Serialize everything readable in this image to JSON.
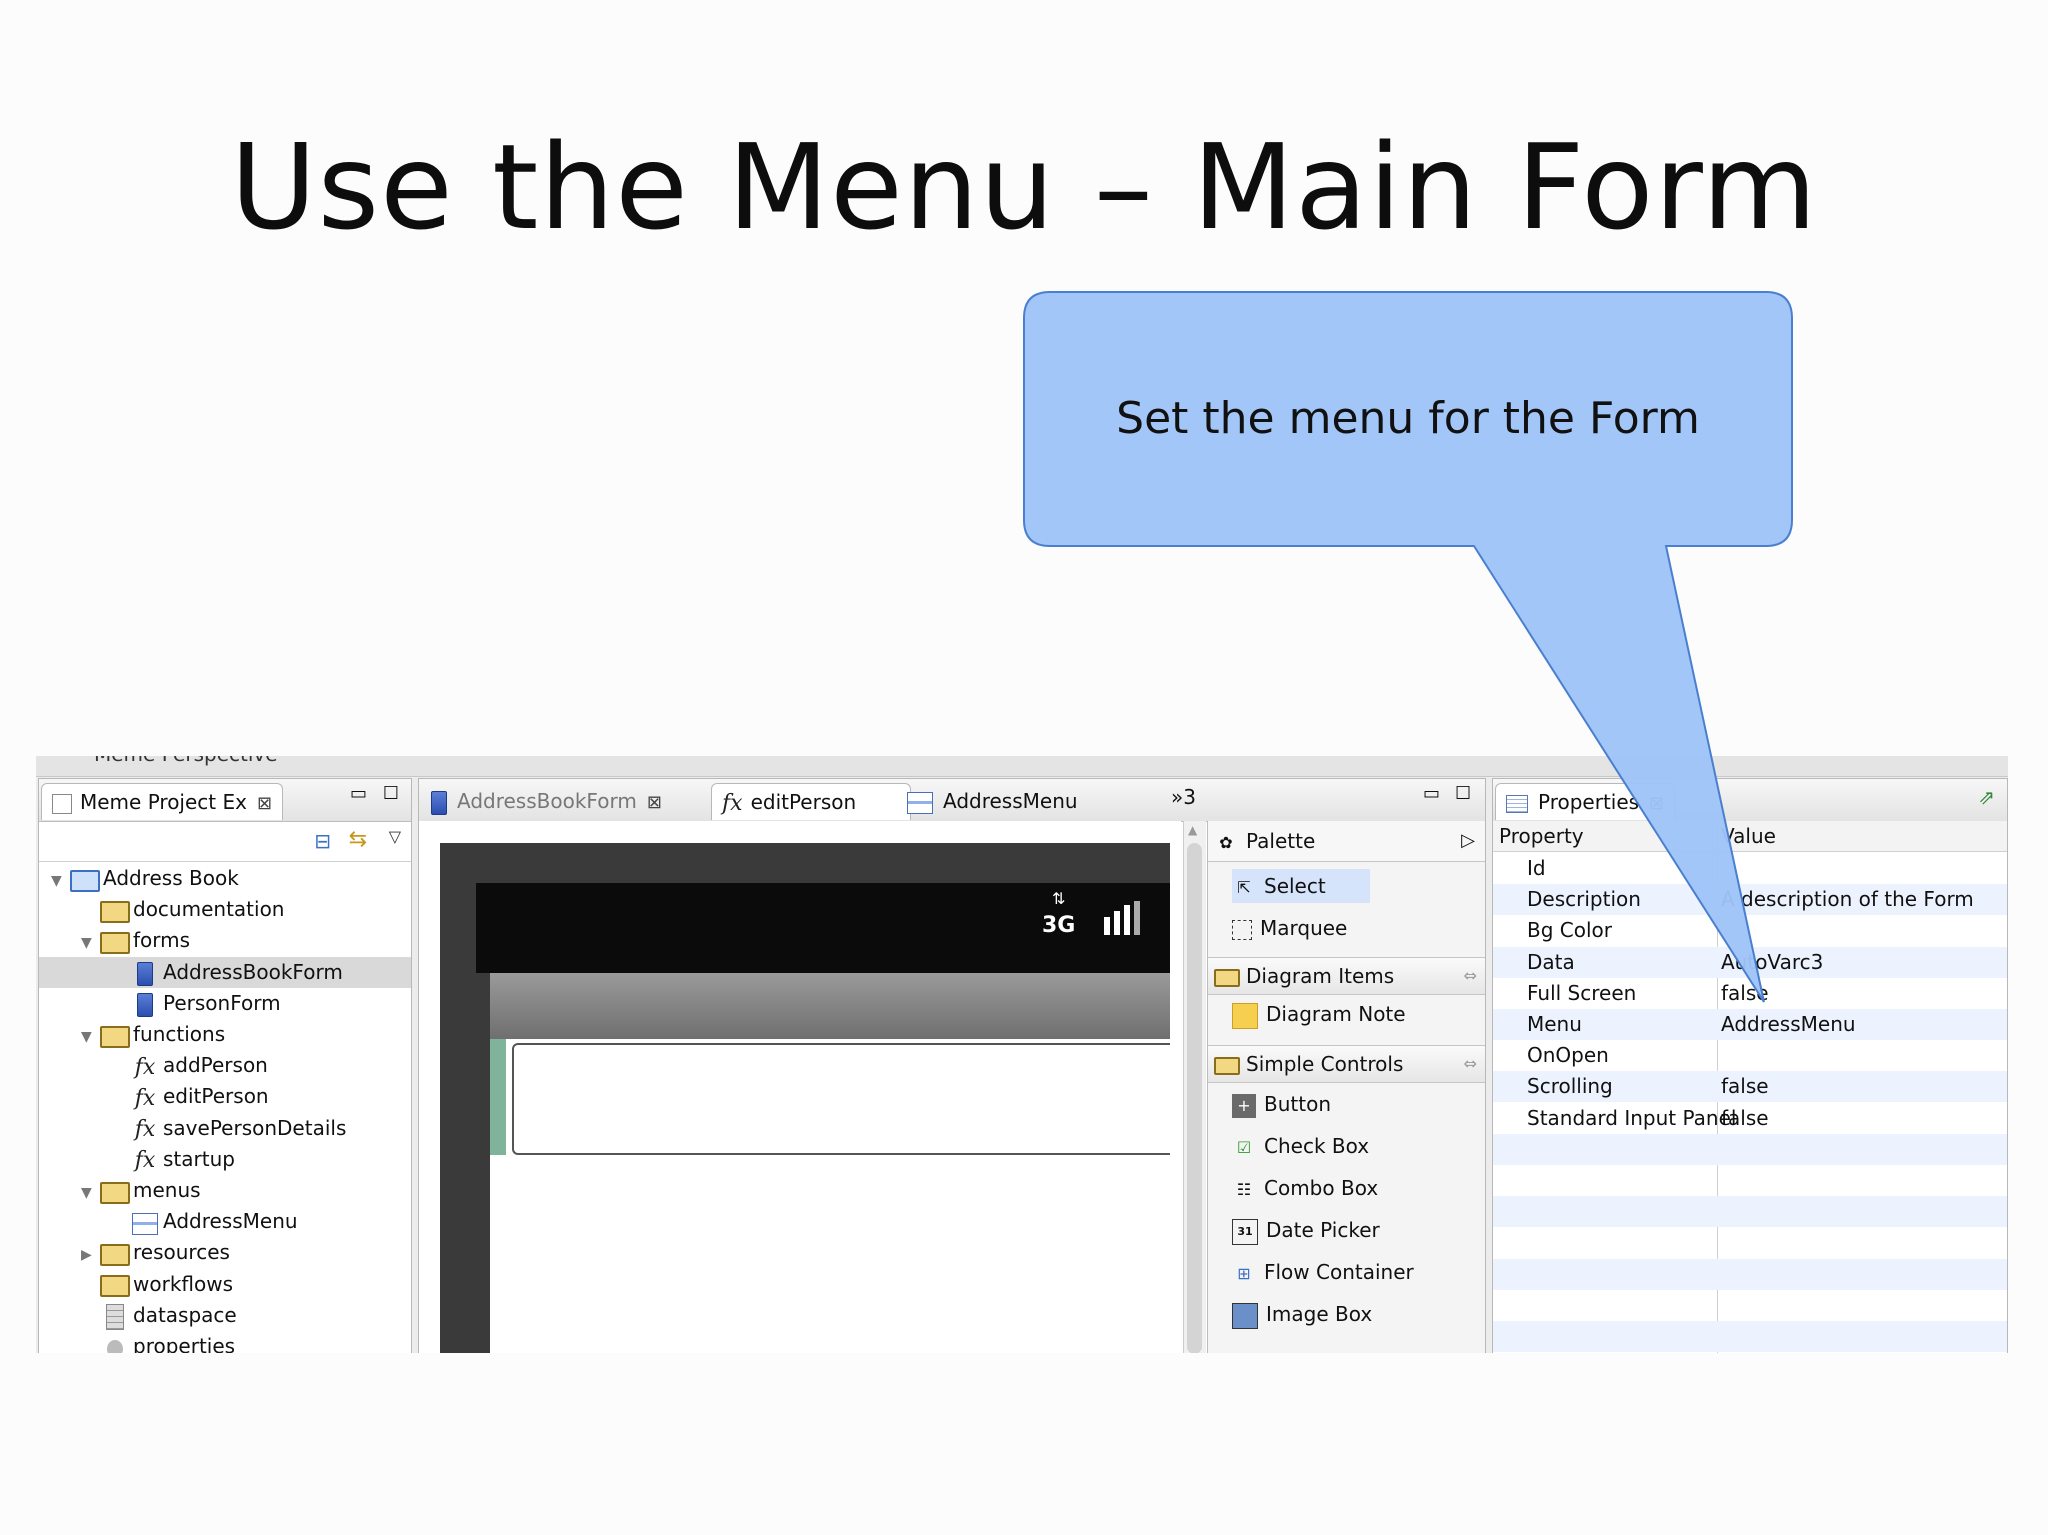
{
  "slide": {
    "title": "Use the Menu – Main Form"
  },
  "callout": {
    "text": "Set the menu for the Form"
  },
  "perspective_label": "Meme Perspective",
  "explorer": {
    "tab_label": "Meme Project Ex",
    "tree": [
      {
        "label": "Address Book",
        "icon": "project-folder-icon",
        "level": 0,
        "expanded": true
      },
      {
        "label": "documentation",
        "icon": "folder-icon",
        "level": 1
      },
      {
        "label": "forms",
        "icon": "folder-icon",
        "level": 1,
        "expanded": true
      },
      {
        "label": "AddressBookForm",
        "icon": "form-icon",
        "level": 2,
        "selected": true
      },
      {
        "label": "PersonForm",
        "icon": "form-icon",
        "level": 2
      },
      {
        "label": "functions",
        "icon": "folder-icon",
        "level": 1,
        "expanded": true
      },
      {
        "label": "addPerson",
        "icon": "function-icon",
        "level": 2
      },
      {
        "label": "editPerson",
        "icon": "function-icon",
        "level": 2
      },
      {
        "label": "savePersonDetails",
        "icon": "function-icon",
        "level": 2
      },
      {
        "label": "startup",
        "icon": "function-icon",
        "level": 2
      },
      {
        "label": "menus",
        "icon": "folder-icon",
        "level": 1,
        "expanded": true
      },
      {
        "label": "AddressMenu",
        "icon": "menu-icon",
        "level": 2
      },
      {
        "label": "resources",
        "icon": "folder-icon",
        "level": 1,
        "collapsed": true
      },
      {
        "label": "workflows",
        "icon": "folder-icon",
        "level": 1
      },
      {
        "label": "dataspace",
        "icon": "database-icon",
        "level": 1
      },
      {
        "label": "properties",
        "icon": "bulb-icon",
        "level": 1
      }
    ]
  },
  "editor": {
    "tabs": [
      {
        "label": "AddressBookForm",
        "icon": "form-icon",
        "state": "inactive"
      },
      {
        "label": "editPerson",
        "icon": "function-icon",
        "state": "active"
      },
      {
        "label": "AddressMenu",
        "icon": "menu-icon",
        "state": "inactive"
      }
    ],
    "overflow_label": "»3",
    "status_bar_network": "3G"
  },
  "palette": {
    "title": "Palette",
    "tools": [
      "Select",
      "Marquee"
    ],
    "groups": [
      {
        "label": "Diagram Items",
        "items": [
          "Diagram Note"
        ]
      },
      {
        "label": "Simple Controls",
        "items": [
          "Button",
          "Check Box",
          "Combo Box",
          "Date Picker",
          "Flow Container",
          "Image Box"
        ]
      }
    ]
  },
  "properties": {
    "tab_label": "Properties",
    "column_property": "Property",
    "column_value": "Value",
    "rows": [
      {
        "name": "Id",
        "value": ""
      },
      {
        "name": "Description",
        "value": "A description of the Form"
      },
      {
        "name": "Bg Color",
        "value": ""
      },
      {
        "name": "Data",
        "value": "AutoVarc3"
      },
      {
        "name": "Full Screen",
        "value": "false"
      },
      {
        "name": "Menu",
        "value": "AddressMenu"
      },
      {
        "name": "OnOpen",
        "value": ""
      },
      {
        "name": "Scrolling",
        "value": "false"
      },
      {
        "name": "Standard Input Panel",
        "value": "false"
      }
    ]
  },
  "colors": {
    "callout_fill": "#9ec4f8",
    "selection": "#d9d9d9",
    "stripe": "#edf3fe"
  }
}
